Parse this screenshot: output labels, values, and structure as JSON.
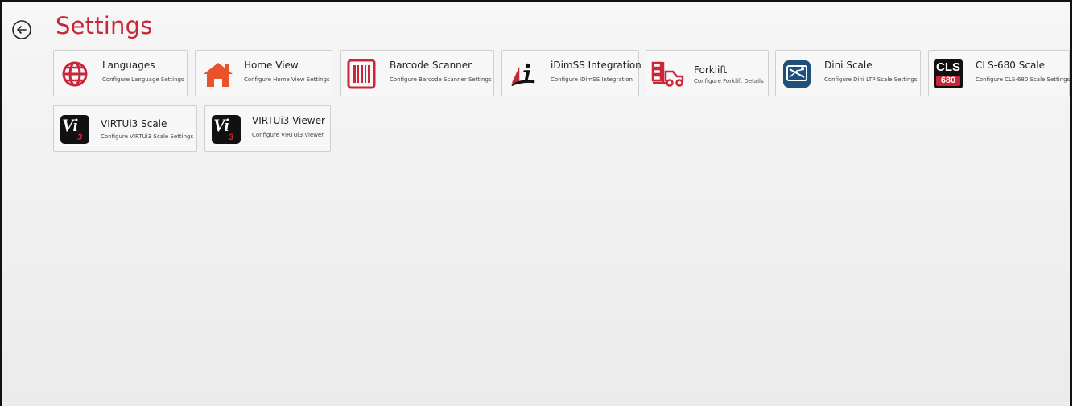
{
  "header": {
    "title": "Settings"
  },
  "icons": {
    "back": "back-circle-arrow-icon"
  },
  "colors": {
    "accent": "#c8273a",
    "dini": "#1f4f7a",
    "dark": "#111111"
  },
  "tiles": [
    {
      "title": "Languages",
      "subtitle": "Configure Language Settings",
      "icon": "globe-icon"
    },
    {
      "title": "Home View",
      "subtitle": "Configure Home View Settings",
      "icon": "home-icon"
    },
    {
      "title": "Barcode Scanner",
      "subtitle": "Configure Barcode Scanner Settings",
      "icon": "barcode-icon"
    },
    {
      "title": "iDimSS Integration",
      "subtitle": "Configure iDimSS Integration",
      "icon": "idimss-logo-icon"
    },
    {
      "title": "Forklift",
      "subtitle": "Configure Forklift Details",
      "icon": "forklift-icon"
    },
    {
      "title": "Dini Scale",
      "subtitle": "Configure Dini LTP Scale Settings",
      "icon": "dini-scale-icon"
    },
    {
      "title": "CLS-680 Scale",
      "subtitle": "Configure CLS-680 Scale Settings",
      "icon": "cls-680-logo-icon",
      "logo_text_top": "CLS",
      "logo_text_bottom": "680"
    },
    {
      "title": "VIRTUi3 Scale",
      "subtitle": "Configure VIRTUi3 Scale Settings",
      "icon": "virtui3-logo-icon",
      "logo_text": "Vi",
      "logo_sub": "3"
    },
    {
      "title": "VIRTUi3 Viewer",
      "subtitle": "Configure VIRTUi3 Viewer",
      "icon": "virtui3-logo-icon",
      "logo_text": "Vi",
      "logo_sub": "3"
    }
  ]
}
